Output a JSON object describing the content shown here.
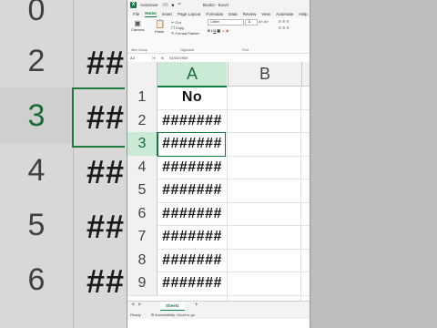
{
  "app": {
    "autosave_label": "AutoSave",
    "file_title": "Book2 - Excel"
  },
  "tabs": [
    "File",
    "Home",
    "Insert",
    "Page Layout",
    "Formulas",
    "Data",
    "Review",
    "View",
    "Automate",
    "Help"
  ],
  "ribbon": {
    "camera": "Camera",
    "paste": "Paste",
    "cut": "Cut",
    "copy": "Copy",
    "format_painter": "Format Painter",
    "group_new": "New Group",
    "group_clipboard": "Clipboard",
    "font_name": "Calibri",
    "font_size": "11",
    "group_font": "Font"
  },
  "formula_bar": {
    "name_box": "A3",
    "fx": "fx",
    "value": "01/01/1900"
  },
  "columns": [
    "A",
    "B"
  ],
  "rows": [
    {
      "n": "1",
      "a": "No"
    },
    {
      "n": "2",
      "a": "#######"
    },
    {
      "n": "3",
      "a": "#######"
    },
    {
      "n": "4",
      "a": "#######"
    },
    {
      "n": "5",
      "a": "#######"
    },
    {
      "n": "6",
      "a": "#######"
    },
    {
      "n": "7",
      "a": "#######"
    },
    {
      "n": "8",
      "a": "#######"
    },
    {
      "n": "9",
      "a": "#######"
    }
  ],
  "sheet_tab": "Sheet1",
  "add_sheet": "+",
  "status": {
    "ready": "Ready",
    "accessibility": "Accessibility: Good to go"
  },
  "background": {
    "nums": [
      "0",
      "2",
      "3",
      "4",
      "5",
      "6"
    ],
    "hash": "##"
  },
  "colors": {
    "excel_green": "#107c41",
    "selected_header": "#caead5"
  }
}
